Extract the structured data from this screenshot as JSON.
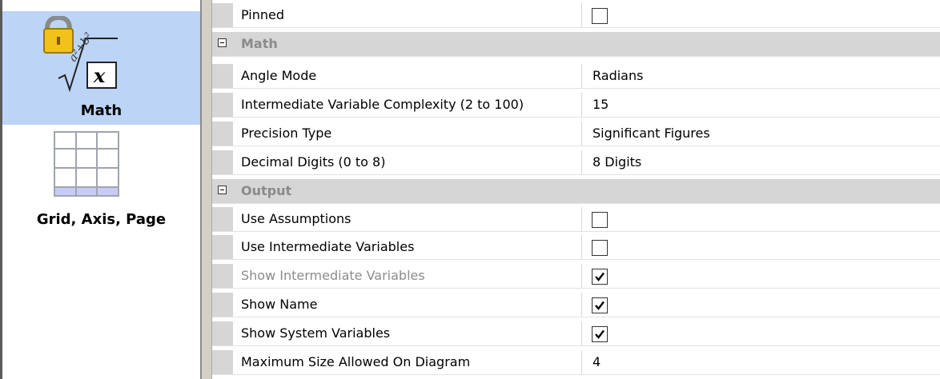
{
  "sidebar": {
    "items": [
      {
        "label": "Math",
        "icon": "math-lock-icon",
        "selected": true
      },
      {
        "label": "Grid, Axis, Page",
        "icon": "grid-icon",
        "selected": false
      }
    ]
  },
  "properties": {
    "top_row": {
      "name": "Pinned",
      "checked": false
    },
    "categories": [
      {
        "title": "Math",
        "rows": [
          {
            "name": "Angle Mode",
            "value": "Radians"
          },
          {
            "name": "Intermediate Variable Complexity (2 to 100)",
            "value": "15"
          },
          {
            "name": "Precision Type",
            "value": "Significant Figures"
          },
          {
            "name": "Decimal Digits (0 to 8)",
            "value": "8 Digits"
          }
        ]
      },
      {
        "title": "Output",
        "rows": [
          {
            "name": "Use Assumptions",
            "checked": false
          },
          {
            "name": "Use Intermediate Variables",
            "checked": false
          },
          {
            "name": "Show Intermediate Variables",
            "checked": true,
            "disabled": true
          },
          {
            "name": "Show Name",
            "checked": true
          },
          {
            "name": "Show System Variables",
            "checked": true
          },
          {
            "name": "Maximum Size Allowed On Diagram",
            "value": "4"
          }
        ]
      }
    ]
  },
  "colors": {
    "selected_bg": "#bcd4f5",
    "category_bg": "#d6d6d6",
    "category_text": "#8a8a8a"
  }
}
